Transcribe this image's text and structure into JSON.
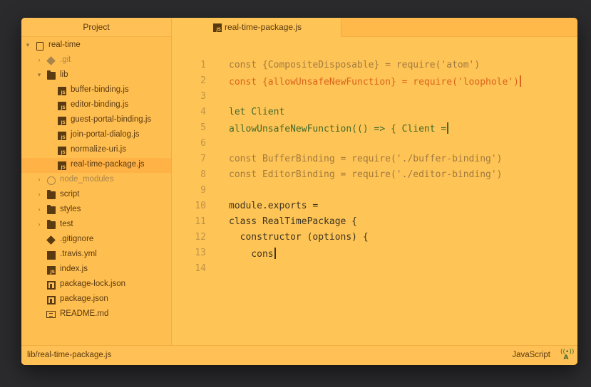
{
  "sidebar": {
    "title": "Project",
    "root": "real-time",
    "items": [
      {
        "label": ".git"
      },
      {
        "label": "lib"
      },
      {
        "label": "buffer-binding.js"
      },
      {
        "label": "editor-binding.js"
      },
      {
        "label": "guest-portal-binding.js"
      },
      {
        "label": "join-portal-dialog.js"
      },
      {
        "label": "normalize-uri.js"
      },
      {
        "label": "real-time-package.js"
      },
      {
        "label": "node_modules"
      },
      {
        "label": "script"
      },
      {
        "label": "styles"
      },
      {
        "label": "test"
      },
      {
        "label": ".gitignore"
      },
      {
        "label": ".travis.yml"
      },
      {
        "label": "index.js"
      },
      {
        "label": "package-lock.json"
      },
      {
        "label": "package.json"
      },
      {
        "label": "README.md"
      }
    ]
  },
  "tab": {
    "icon_text": "JS",
    "label": "real-time-package.js"
  },
  "editor": {
    "lines": [
      {
        "num": "1",
        "text": "const {CompositeDisposable} = require('atom')"
      },
      {
        "num": "2",
        "text": "const {allowUnsafeNewFunction} = require('loophole')"
      },
      {
        "num": "3",
        "text": ""
      },
      {
        "num": "4",
        "text": "let Client"
      },
      {
        "num": "5",
        "text": "allowUnsafeNewFunction(() => { Client ="
      },
      {
        "num": "6",
        "text": ""
      },
      {
        "num": "7",
        "text": "const BufferBinding = require('./buffer-binding')"
      },
      {
        "num": "8",
        "text": "const EditorBinding = require('./editor-binding')"
      },
      {
        "num": "9",
        "text": ""
      },
      {
        "num": "10",
        "text": "module.exports ="
      },
      {
        "num": "11",
        "text": "class RealTimePackage {"
      },
      {
        "num": "12",
        "text": "  constructor (options) {"
      },
      {
        "num": "13",
        "text": "    cons"
      },
      {
        "num": "14",
        "text": ""
      }
    ]
  },
  "statusbar": {
    "path": "lib/real-time-package.js",
    "language": "JavaScript",
    "icon_text": "A"
  },
  "colors": {
    "background": "#ffc456",
    "accent": "#d9641c",
    "text": "#5a3a10"
  }
}
